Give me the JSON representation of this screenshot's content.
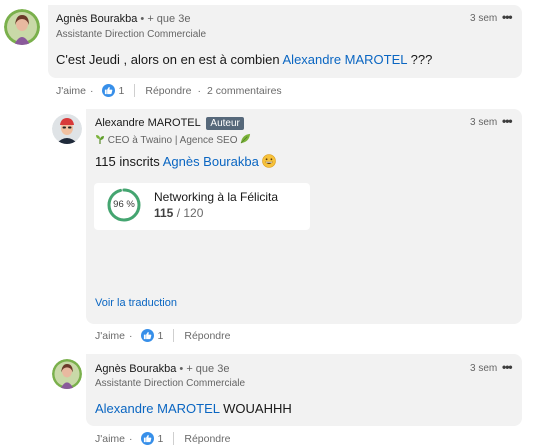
{
  "comment1": {
    "author": "Agnès Bourakba",
    "degree": "• + que 3e",
    "headline": "Assistante Direction Commerciale",
    "time": "3 sem",
    "text_before": "C'est Jeudi , alors on en est à combien",
    "mention": "Alexandre MAROTEL",
    "text_after": "???",
    "actions": {
      "like": "J'aime",
      "like_count": "1",
      "reply": "Répondre",
      "comments": "2 commentaires"
    }
  },
  "reply1": {
    "author": "Alexandre MAROTEL",
    "badge": "Auteur",
    "headline": "CEO à Twaino | Agence SEO",
    "time": "3 sem",
    "text_before": "115 inscrits",
    "mention": "Agnès Bourakba",
    "poll": {
      "percent": "96 %",
      "percent_value": 96,
      "title": "Networking à la Félicita",
      "count": "115",
      "total": "/ 120"
    },
    "translate": "Voir la traduction",
    "actions": {
      "like": "J'aime",
      "like_count": "1",
      "reply": "Répondre"
    }
  },
  "reply2": {
    "author": "Agnès Bourakba",
    "degree": "• + que 3e",
    "headline": "Assistante Direction Commerciale",
    "time": "3 sem",
    "mention": "Alexandre MAROTEL",
    "text_after": "WOUAHHH",
    "actions": {
      "like": "J'aime",
      "like_count": "1",
      "reply": "Répondre"
    }
  },
  "colors": {
    "bubble": "#f2f2f2",
    "link": "#0a66c2",
    "like": "#378fe9",
    "poll_ring": "#44a570"
  },
  "icons": [
    "more-options-icon",
    "like-reaction-icon",
    "seedling-icon",
    "leaf-icon",
    "grin-emoji-icon"
  ]
}
